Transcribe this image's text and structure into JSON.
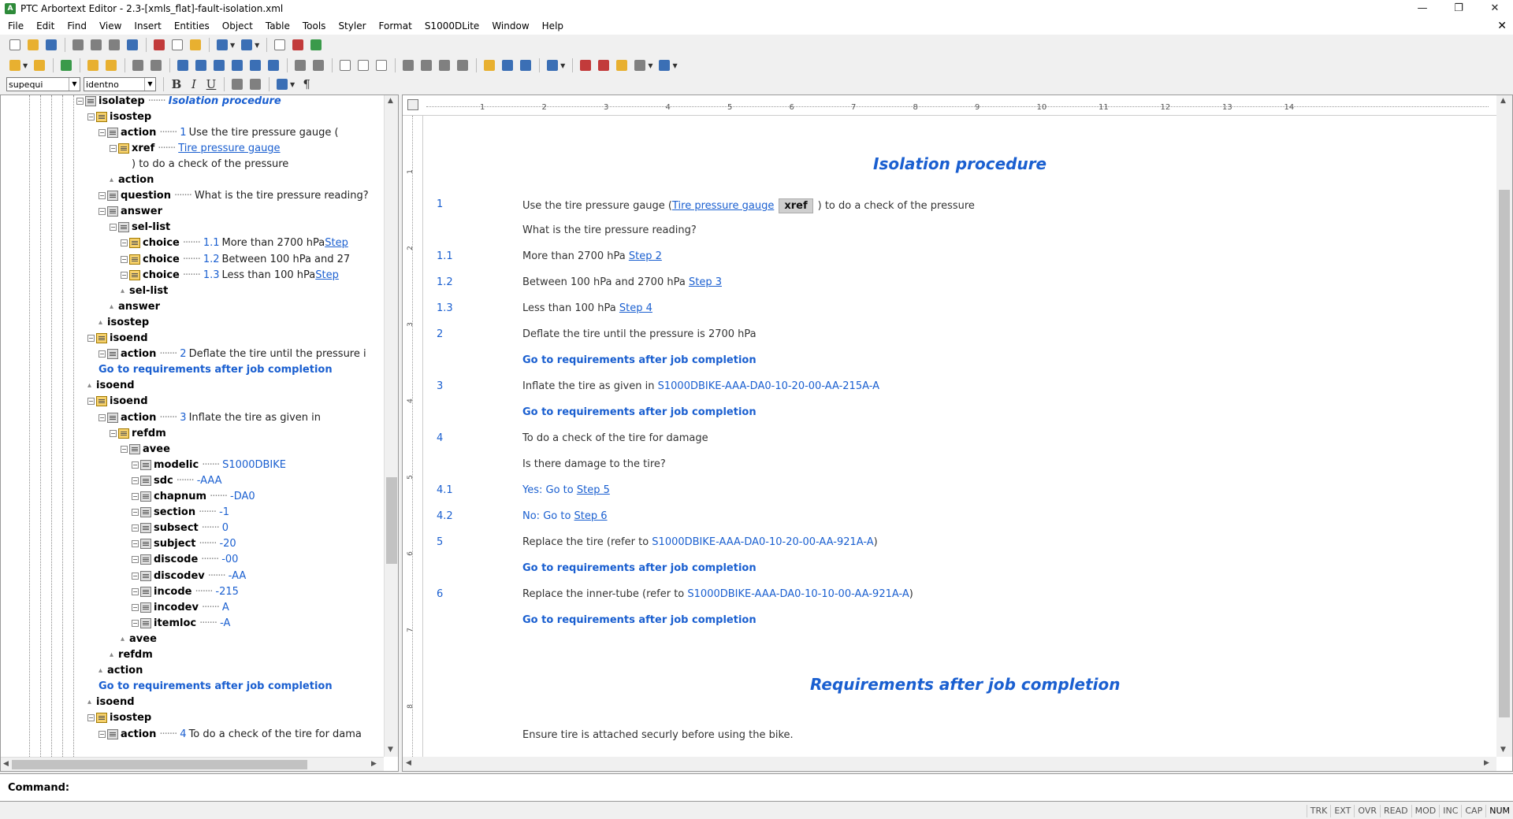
{
  "window": {
    "title": "PTC Arbortext Editor - 2.3-[xmls_flat]-fault-isolation.xml",
    "minimize": "—",
    "restore": "❐",
    "close": "✕",
    "doc_close": "✕"
  },
  "menu": [
    "File",
    "Edit",
    "Find",
    "View",
    "Insert",
    "Entities",
    "Object",
    "Table",
    "Tools",
    "Styler",
    "Format",
    "S1000DLite",
    "Window",
    "Help"
  ],
  "toolbar3": {
    "style_combo": "supequi",
    "attr_combo": "identno",
    "bold": "B",
    "italic": "I",
    "underline": "U",
    "pilcrow": "¶"
  },
  "ruler": {
    "ticks": [
      "1",
      "2",
      "3",
      "4",
      "5",
      "6",
      "7",
      "8",
      "9",
      "10",
      "11",
      "12",
      "13",
      "14"
    ],
    "vticks": [
      "1",
      "2",
      "3",
      "4",
      "5",
      "6",
      "7",
      "8"
    ]
  },
  "tree": [
    {
      "name": "isolatep",
      "title": "Isolation procedure",
      "kind": "title"
    },
    {
      "name": "isostep"
    },
    {
      "name": "action",
      "num": "1",
      "text": "Use the tire pressure gauge ("
    },
    {
      "name": "xref",
      "link": "Tire pressure gauge"
    },
    {
      "text": ") to do a check of the pressure",
      "kind": "text"
    },
    {
      "name": "action",
      "kind": "end"
    },
    {
      "name": "question",
      "text": "What is the tire pressure reading?"
    },
    {
      "name": "answer"
    },
    {
      "name": "sel-list"
    },
    {
      "name": "choice",
      "num": "1.1",
      "text": "More than 2700 hPa",
      "link": "Step"
    },
    {
      "name": "choice",
      "num": "1.2",
      "text": "Between 100 hPa and 27"
    },
    {
      "name": "choice",
      "num": "1.3",
      "text": "Less than 100 hPa",
      "link": "Step"
    },
    {
      "name": "sel-list",
      "kind": "end"
    },
    {
      "name": "answer",
      "kind": "end"
    },
    {
      "name": "isostep",
      "kind": "end"
    },
    {
      "name": "isoend"
    },
    {
      "name": "action",
      "num": "2",
      "text": "Deflate the tire until the pressure i"
    },
    {
      "text": "Go to requirements after job completion",
      "kind": "go"
    },
    {
      "name": "isoend",
      "kind": "end"
    },
    {
      "name": "isoend"
    },
    {
      "name": "action",
      "num": "3",
      "text": "Inflate the tire as given in"
    },
    {
      "name": "refdm"
    },
    {
      "name": "avee"
    },
    {
      "name": "modelic",
      "val": "S1000DBIKE"
    },
    {
      "name": "sdc",
      "val": "-AAA"
    },
    {
      "name": "chapnum",
      "val": "-DA0"
    },
    {
      "name": "section",
      "val": "-1"
    },
    {
      "name": "subsect",
      "val": "0"
    },
    {
      "name": "subject",
      "val": "-20"
    },
    {
      "name": "discode",
      "val": "-00"
    },
    {
      "name": "discodev",
      "val": "-AA"
    },
    {
      "name": "incode",
      "val": "-215"
    },
    {
      "name": "incodev",
      "val": "A"
    },
    {
      "name": "itemloc",
      "val": "-A"
    },
    {
      "name": "avee",
      "kind": "end"
    },
    {
      "name": "refdm",
      "kind": "end"
    },
    {
      "name": "action",
      "kind": "end"
    },
    {
      "text": "Go to requirements after job completion",
      "kind": "go"
    },
    {
      "name": "isoend",
      "kind": "end"
    },
    {
      "name": "isostep"
    },
    {
      "name": "action",
      "num": "4",
      "text": "To do a check of the tire for dama"
    }
  ],
  "doc": {
    "heading1": "Isolation procedure",
    "s1_num": "1",
    "s1_a": "Use the tire pressure gauge (",
    "s1_link": "Tire pressure gauge",
    "s1_tag": "xref",
    "s1_b": ") to do a check of the pressure",
    "question": "What is the tire pressure reading?",
    "c11_num": "1.1",
    "c11_text": "More than 2700 hPa",
    "c11_link": "Step 2",
    "c12_num": "1.2",
    "c12_text": "Between 100 hPa and 2700 hPa",
    "c12_link": "Step 3",
    "c13_num": "1.3",
    "c13_text": "Less than 100 hPa",
    "c13_link": "Step 4",
    "s2_num": "2",
    "s2_text": "Deflate the tire until the pressure is 2700 hPa",
    "go": "Go to requirements after job completion",
    "s3_num": "3",
    "s3_text": "Inflate the tire as given in",
    "s3_ref": "S1000DBIKE-AAA-DA0-10-20-00-AA-215A-A",
    "s4_num": "4",
    "s4_text": "To do a check of the tire for damage",
    "q2": "Is there damage to the tire?",
    "c41_num": "4.1",
    "c41_text": "Yes: Go to",
    "c41_link": "Step 5",
    "c42_num": "4.2",
    "c42_text": "No: Go to",
    "c42_link": "Step 6",
    "s5_num": "5",
    "s5_a": "Replace the tire (refer to",
    "s5_ref": "S1000DBIKE-AAA-DA0-10-20-00-AA-921A-A",
    "s5_b": ")",
    "s6_num": "6",
    "s6_a": "Replace the inner-tube (refer to",
    "s6_ref": "S1000DBIKE-AAA-DA0-10-10-00-AA-921A-A",
    "s6_b": ")",
    "heading2": "Requirements after job completion",
    "req_text": "Ensure tire is attached securly before using the bike."
  },
  "command": {
    "label": "Command:",
    "value": ""
  },
  "status": [
    "TRK",
    "EXT",
    "OVR",
    "READ",
    "MOD",
    "INC",
    "CAP",
    "NUM"
  ]
}
